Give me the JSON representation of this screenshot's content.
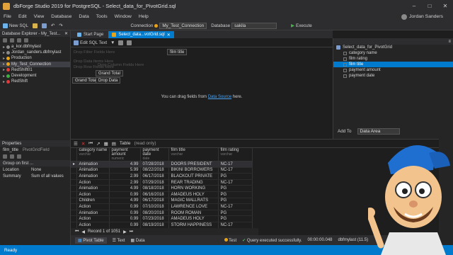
{
  "window": {
    "title": "dbForge Studio 2019 for PostgreSQL - Select_data_for_PivotGrid.sql"
  },
  "menu": [
    "File",
    "Edit",
    "View",
    "Database",
    "Data",
    "Tools",
    "Window",
    "Help"
  ],
  "user": "Jordan Sanders",
  "toolbar": {
    "new_sql": "New SQL",
    "connection_label": "Connection",
    "connection_value": "My_Test_Connection",
    "database_label": "Database",
    "database_value": "sakila",
    "execute": "Execute"
  },
  "explorer": {
    "title": "Database Explorer - My_Test...",
    "items": [
      {
        "label": "a_kor.dbfmylast",
        "color": "#8a8a8a"
      },
      {
        "label": "Jordan_sanders.dbfmylast",
        "color": "#8a8a8a"
      },
      {
        "label": "Production",
        "color": "#e8a317"
      },
      {
        "label": "My_Test_Connection",
        "color": "#e8a317"
      },
      {
        "label": "RedShift01",
        "color": "#e03a3a"
      },
      {
        "label": "Development",
        "color": "#3cb043"
      },
      {
        "label": "RedShift",
        "color": "#e03a3a"
      }
    ]
  },
  "properties": {
    "title": "Properties",
    "subject": "film_title",
    "subject_type": "PivotGridField",
    "group": "Group on first ...",
    "rows": [
      {
        "k": "Location",
        "v": "None"
      },
      {
        "k": "Summary",
        "v": "Sum of all values"
      }
    ]
  },
  "tabs": [
    {
      "label": "Start Page"
    },
    {
      "label": "Select_data...votGrid.sql"
    }
  ],
  "pivot": {
    "edit_sql": "Edit SQL Text",
    "filter_hint": "Drop Filter Fields Here",
    "data_hint": "Drop Data Items Here",
    "row_hint": "Drop Row Fields Here",
    "col_hint": "Drop Column Fields Here",
    "field_box": "film title",
    "grand_total": "Grand Total",
    "grand_total2": "Grand Total",
    "drop_data": "Drop Data",
    "empty_msg": "You can drag fields from ",
    "data_source": "Data Source",
    "empty_tail": " here."
  },
  "field_list": {
    "root": "Select_data_for_PivotGrid",
    "fields": [
      {
        "label": "category name",
        "on": false
      },
      {
        "label": "film rating",
        "on": false
      },
      {
        "label": "film title",
        "on": true
      },
      {
        "label": "payment amount",
        "on": false
      },
      {
        "label": "payment date",
        "on": false
      }
    ],
    "add_to": "Add To",
    "area": "Data Area"
  },
  "grid": {
    "table_label": "Table",
    "mode": "(read only)",
    "columns": [
      {
        "name": "category name",
        "type": "varchar"
      },
      {
        "name": "payment amount",
        "type": "numeric"
      },
      {
        "name": "payment date",
        "type": "date"
      },
      {
        "name": "film title",
        "type": "varchar"
      },
      {
        "name": "film rating",
        "type": "varchar"
      }
    ],
    "rows": [
      [
        "Animation",
        "4.99",
        "07/28/2018",
        "DOORS PRESIDENT",
        "NC-17"
      ],
      [
        "Animation",
        "5.99",
        "08/22/2018",
        "BIKINI BORROWERS",
        "NC-17"
      ],
      [
        "Animation",
        "2.99",
        "06/17/2018",
        "BLACKOUT PRIVATE",
        "PG"
      ],
      [
        "Action",
        "2.99",
        "07/29/2018",
        "REAR TRADING",
        "NC-17"
      ],
      [
        "Animation",
        "4.99",
        "08/18/2018",
        "HORN WORKING",
        "PG"
      ],
      [
        "Action",
        "0.99",
        "06/16/2018",
        "AMADEUS HOLY",
        "PG"
      ],
      [
        "Children",
        "4.99",
        "06/17/2018",
        "MAGIC MALLRATS",
        "PG"
      ],
      [
        "Action",
        "0.99",
        "07/10/2018",
        "LAWRENCE LOVE",
        "NC-17"
      ],
      [
        "Animation",
        "0.99",
        "08/20/2018",
        "ROOM ROMAN",
        "PG"
      ],
      [
        "Action",
        "0.99",
        "07/23/2018",
        "AMADEUS HOLY",
        "PG"
      ],
      [
        "Action",
        "0.99",
        "08/19/2018",
        "STORM HAPPINESS",
        "NC-17"
      ]
    ],
    "record": "Record 1 of 1051"
  },
  "bottom_tabs": [
    "Pivot Table",
    "Text",
    "Data",
    "Test"
  ],
  "status": {
    "ready": "Ready",
    "msg": "Query executed successfully.",
    "time": "00:00:00.048",
    "conn": "dbfmylast (11.5)",
    "db": "postgre..."
  }
}
